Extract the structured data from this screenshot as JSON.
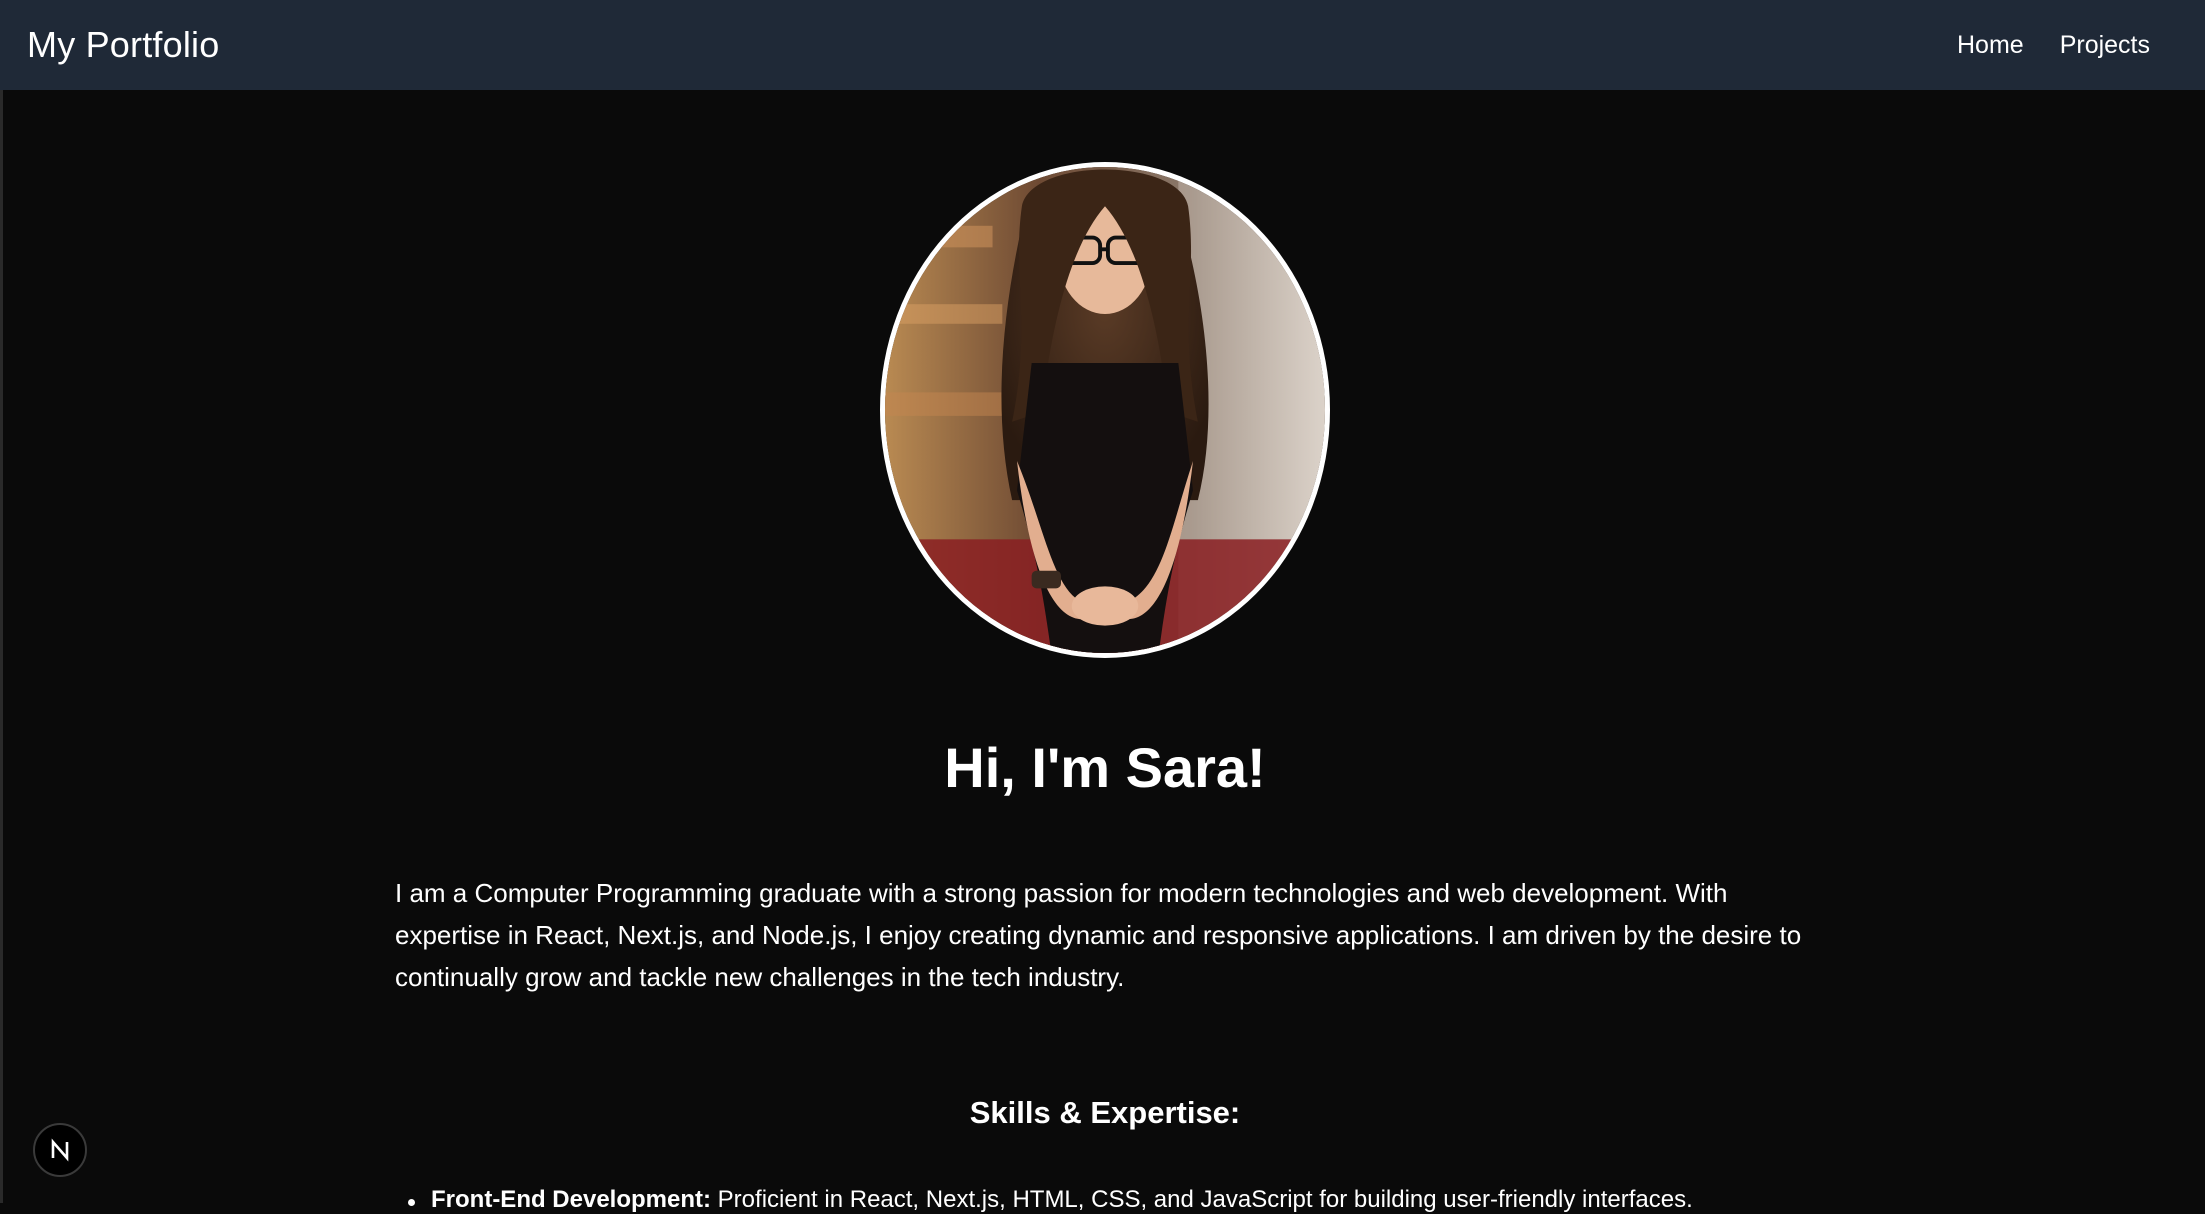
{
  "navbar": {
    "brand": "My Portfolio",
    "links": [
      {
        "label": "Home"
      },
      {
        "label": "Projects"
      }
    ]
  },
  "hero": {
    "heading": "Hi, I'm Sara!",
    "intro": "I am a Computer Programming graduate with a strong passion for modern technologies and web development. With expertise in React, Next.js, and Node.js, I enjoy creating dynamic and responsive applications. I am driven by the desire to continually grow and tackle new challenges in the tech industry."
  },
  "skills": {
    "title": "Skills & Expertise:",
    "items": [
      {
        "label": "Front-End Development:",
        "text": "Proficient in React, Next.js, HTML, CSS, and JavaScript for building user-friendly interfaces."
      }
    ]
  },
  "badge": {
    "icon": "nextjs-logo-icon",
    "letter": "N"
  },
  "colors": {
    "navbar_bg": "#1f2937",
    "page_bg": "#0a0a0a",
    "text": "#ffffff"
  }
}
